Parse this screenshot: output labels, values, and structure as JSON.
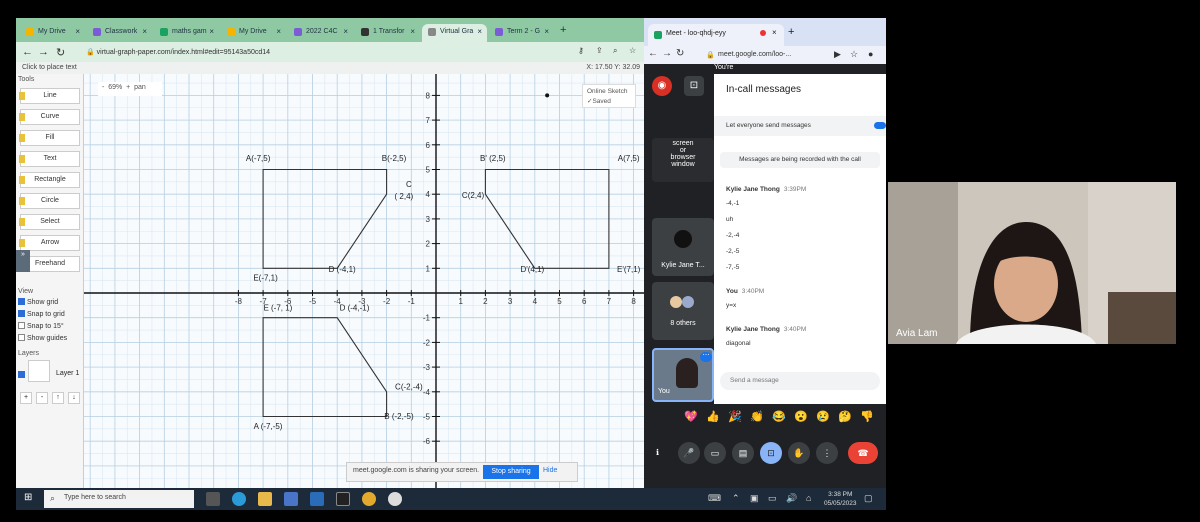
{
  "left_browser": {
    "tabs": [
      {
        "label": "My Drive",
        "color": "#f4b400",
        "active": false
      },
      {
        "label": "Classwork",
        "color": "#7b5cd6",
        "active": false
      },
      {
        "label": "maths gam",
        "color": "#1aa260",
        "active": false
      },
      {
        "label": "My Drive",
        "color": "#f4b400",
        "active": false
      },
      {
        "label": "2022 C4C",
        "color": "#7b5cd6",
        "active": false
      },
      {
        "label": "1 Transfor",
        "color": "#333333",
        "active": false
      },
      {
        "label": "Virtual Gra",
        "color": "#888888",
        "active": true
      },
      {
        "label": "Term 2 - G",
        "color": "#7b5cd6",
        "active": false
      }
    ],
    "new_tab": "+",
    "url": "virtual-graph-paper.com/index.html#edit=95143a50cd14",
    "status_left": "Click to place text",
    "status_right": "X: 17.50 Y: 32.09",
    "tools_header": "Tools",
    "tools": [
      "Line",
      "Curve",
      "Fill",
      "Text",
      "Rectangle",
      "Circle",
      "Select",
      "Arrow",
      "Freehand"
    ],
    "view_header": "View",
    "view_options": [
      {
        "label": "Show grid",
        "checked": true
      },
      {
        "label": "Snap to grid",
        "checked": true
      },
      {
        "label": "Snap to 15°",
        "checked": false
      },
      {
        "label": "Show guides",
        "checked": false
      }
    ],
    "layers_header": "Layers",
    "layer_name": "Layer 1",
    "layer_buttons": [
      "+",
      "-",
      "↑",
      "↓"
    ],
    "zoom": "69%",
    "zoom_minus": "-",
    "zoom_plus": "+",
    "pan_label": "pan",
    "save_status": [
      "Online Sketch",
      "✓Saved"
    ],
    "sharing_text": "meet.google.com is sharing your screen.",
    "stop_sharing": "Stop sharing",
    "hide": "Hide"
  },
  "graph": {
    "x_ticks": [
      "-8",
      "-7",
      "-6",
      "-5",
      "-4",
      "-3",
      "-2",
      "-1",
      "1",
      "2",
      "3",
      "4",
      "5",
      "6",
      "7",
      "8"
    ],
    "y_ticks": [
      "8",
      "7",
      "6",
      "5",
      "4",
      "3",
      "2",
      "1",
      "-1",
      "-2",
      "-3",
      "-4",
      "-5",
      "-6"
    ],
    "shapes": [
      {
        "name": "original",
        "points": [
          [
            -7,
            5
          ],
          [
            -2,
            5
          ],
          [
            -2,
            4
          ],
          [
            -4,
            1
          ],
          [
            -7,
            1
          ]
        ]
      },
      {
        "name": "reflection-y-axis",
        "points": [
          [
            2,
            5
          ],
          [
            7,
            5
          ],
          [
            7,
            1
          ],
          [
            4,
            1
          ],
          [
            2,
            4
          ]
        ]
      },
      {
        "name": "reflection-x-axis",
        "points": [
          [
            -7,
            -1
          ],
          [
            -4,
            -1
          ],
          [
            -2,
            -4
          ],
          [
            -2,
            -5
          ],
          [
            -7,
            -5
          ]
        ]
      }
    ],
    "point_marker": [
      4.5,
      8
    ],
    "labels": {
      "a": "A(-7,5)",
      "b": "B(-2,5)",
      "c1": "C",
      "c2": "( 2,4)",
      "d": "D (-4,1)",
      "e": "E(-7,1)",
      "bp": "B' (2,5)",
      "ap": "A(7,5)",
      "cp": "C(2,4)",
      "dp": "D'(4,1)",
      "ep": "E'(7,1)",
      "e2": "E (-7, 1)",
      "d2": "D (-4,-1)",
      "c3": "C(-2,-4)",
      "b3": "B (-2,-5)",
      "a3": "A (-7,-5)"
    }
  },
  "right_browser": {
    "tab_label": "Meet - loo-qhdj-eyy",
    "url": "meet.google.com/loo-...",
    "you_label": "You're",
    "panel_title": "In-call messages",
    "allow_label": "Let everyone send messages",
    "recorded_note": "Messages are being recorded with the call",
    "messages": [
      {
        "sender": "Kylie Jane Thong",
        "time": "3:39PM",
        "lines": [
          "-4,-1",
          "uh",
          "-2,-4",
          "-2,-5",
          "-7,-5"
        ]
      },
      {
        "sender": "You",
        "time": "3:40PM",
        "lines": [
          "y=x"
        ]
      },
      {
        "sender": "Kylie Jane Thong",
        "time": "3:40PM",
        "lines": [
          "diagonal"
        ]
      }
    ],
    "send_placeholder": "Send a message",
    "tile_screen": [
      "screen",
      "or",
      "browser",
      "window"
    ],
    "tile_kylie": "Kylie Jane T...",
    "tile_others": "8 others",
    "tile_you": "You",
    "reactions": [
      "💖",
      "👍",
      "🎉",
      "👏",
      "😂",
      "😮",
      "😢",
      "🤔",
      "👎"
    ]
  },
  "taskbar": {
    "search_placeholder": "Type here to search",
    "time": "3:38 PM",
    "date": "05/05/2023"
  },
  "webcam": {
    "name": "Avia Lam"
  }
}
